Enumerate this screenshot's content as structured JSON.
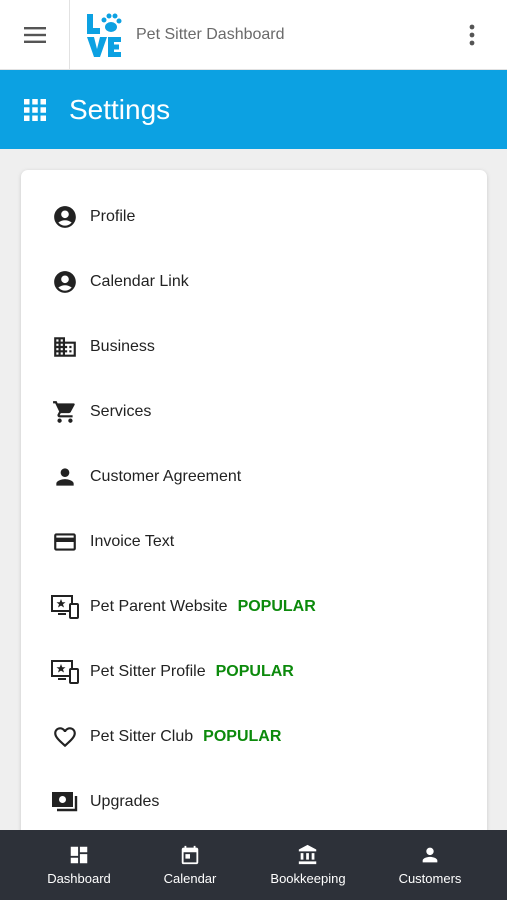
{
  "topbar": {
    "title": "Pet Sitter Dashboard",
    "menu_icon": "hamburger-menu-icon",
    "more_icon": "more-vert-icon",
    "logo_text": "LOVE",
    "logo_color": "#0ca1e2"
  },
  "header": {
    "title": "Settings",
    "icon": "apps-grid-icon",
    "background": "#0ca1e2"
  },
  "settings": {
    "items": [
      {
        "label": "Profile",
        "icon": "account-circle-icon"
      },
      {
        "label": "Calendar Link",
        "icon": "account-circle-icon"
      },
      {
        "label": "Business",
        "icon": "business-icon"
      },
      {
        "label": "Services",
        "icon": "shopping-cart-icon"
      },
      {
        "label": "Customer Agreement",
        "icon": "person-icon"
      },
      {
        "label": "Invoice Text",
        "icon": "credit-card-icon"
      },
      {
        "label": "Pet Parent Website",
        "icon": "devices-star-icon",
        "badge": "POPULAR"
      },
      {
        "label": "Pet Sitter Profile",
        "icon": "devices-star-icon",
        "badge": "POPULAR"
      },
      {
        "label": "Pet Sitter Club",
        "icon": "heart-outline-icon",
        "badge": "POPULAR"
      },
      {
        "label": "Upgrades",
        "icon": "payments-icon"
      }
    ],
    "badge_color": "#0c8a0c"
  },
  "bottom_nav": {
    "background": "#2d3139",
    "items": [
      {
        "label": "Dashboard",
        "icon": "dashboard-icon"
      },
      {
        "label": "Calendar",
        "icon": "calendar-icon"
      },
      {
        "label": "Bookkeeping",
        "icon": "bank-icon"
      },
      {
        "label": "Customers",
        "icon": "person-icon"
      }
    ]
  }
}
